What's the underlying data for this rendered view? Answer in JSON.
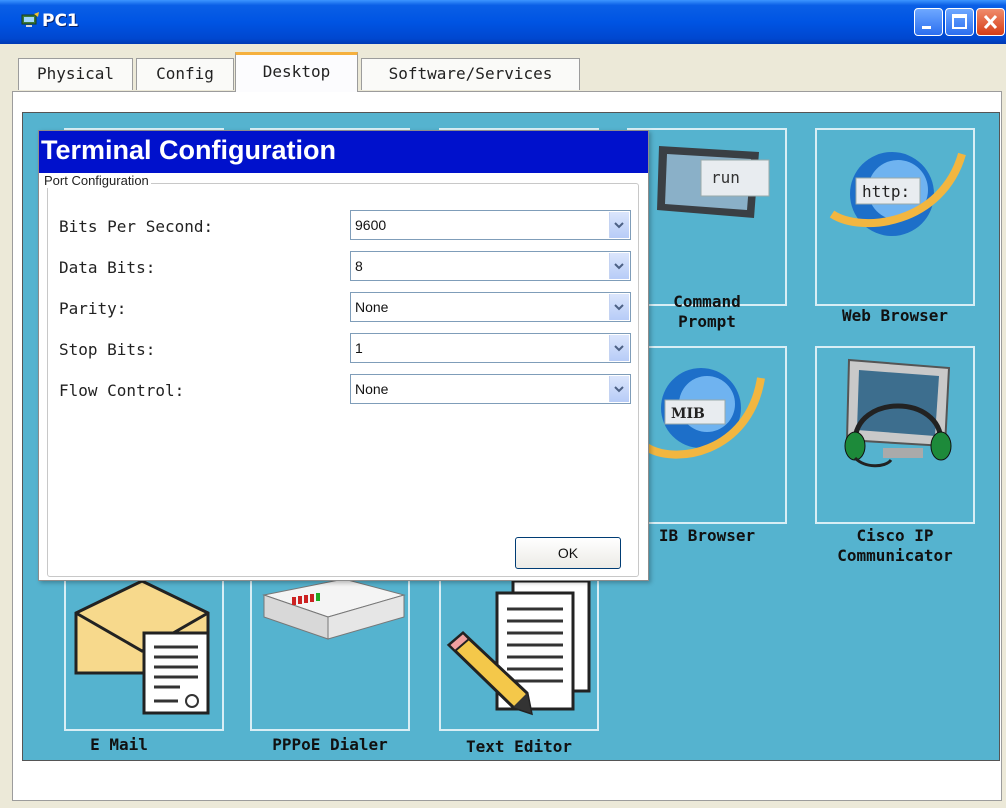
{
  "window": {
    "title": "PC1"
  },
  "tabs": [
    "Physical",
    "Config",
    "Desktop",
    "Software/Services"
  ],
  "active_tab": "Desktop",
  "desktop_apps": {
    "command_prompt": {
      "label": "Command Prompt",
      "line1": "Command",
      "line2": "Prompt",
      "icon_text": "run"
    },
    "web_browser": {
      "label": "Web Browser",
      "icon_text": "http:"
    },
    "mib_browser": {
      "label": "IB Browser",
      "icon_text": "MIB"
    },
    "cisco_ip": {
      "line1": "Cisco IP",
      "line2": "Communicator"
    },
    "email": {
      "label": "E Mail"
    },
    "pppoe": {
      "label": "PPPoE Dialer"
    },
    "text_editor": {
      "label": "Text Editor"
    }
  },
  "dialog": {
    "title": "Terminal Configuration",
    "group_label": "Port Configuration",
    "fields": [
      {
        "label": "Bits Per Second:",
        "value": "9600"
      },
      {
        "label": "Data Bits:",
        "value": "8"
      },
      {
        "label": "Parity:",
        "value": "None"
      },
      {
        "label": "Stop Bits:",
        "value": "1"
      },
      {
        "label": "Flow Control:",
        "value": "None"
      }
    ],
    "ok_label": "OK"
  },
  "colors": {
    "desktop_bg": "#55b3cf",
    "dialog_title_bg": "#0011cc",
    "titlebar_blue": "#0054e3"
  }
}
